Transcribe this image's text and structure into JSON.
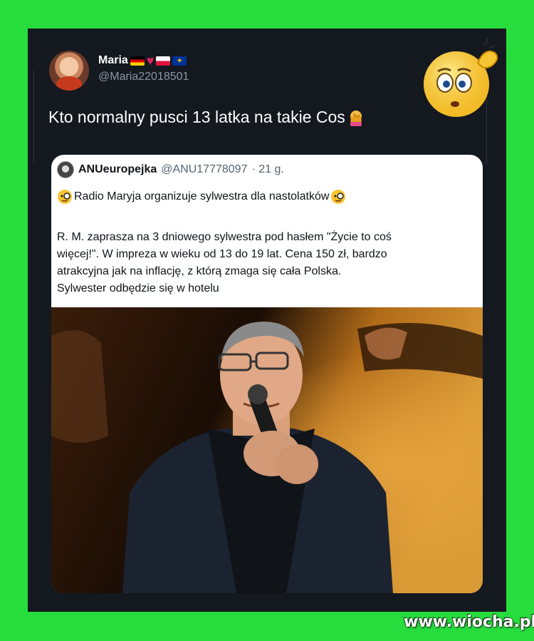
{
  "tweet": {
    "author_name": "Maria",
    "author_handle": "@Maria22018501",
    "name_decorations": [
      "flag-germany-icon",
      "heart-icon",
      "flag-poland-icon",
      "flag-eu-icon"
    ],
    "text": "Kto normalny pusci 13 latka na takie Cos",
    "text_emoji": "person-facepalming-icon"
  },
  "quoted_tweet": {
    "author_name": "ANUeuropejka",
    "author_handle": "@ANU17778097",
    "time": "· 21 g.",
    "headline": "Radio Maryja organizuje sylwestra dla nastolatków",
    "headline_emoji": "face-with-monocle-icon",
    "body": "R. M. zaprasza na 3 dniowego sylwestra pod hasłem \"Życie to coś\nwięcej!\". W impreza w wieku od 13 do 19 lat. Cena 150 zł, bardzo\natrakcyjna jak na inflację, z którą zmaga się cała Polska.\nSylwester odbędzie się w hotelu",
    "photo": "man-with-microphone-on-stage-photo"
  },
  "overlay": {
    "sticker": "confused-scratching-head-emoji",
    "watermark": "www.wiocha.pl"
  },
  "colors": {
    "page_background": "#27dc3d",
    "card_background": "#14181f",
    "muted_text": "#8b98a5"
  }
}
